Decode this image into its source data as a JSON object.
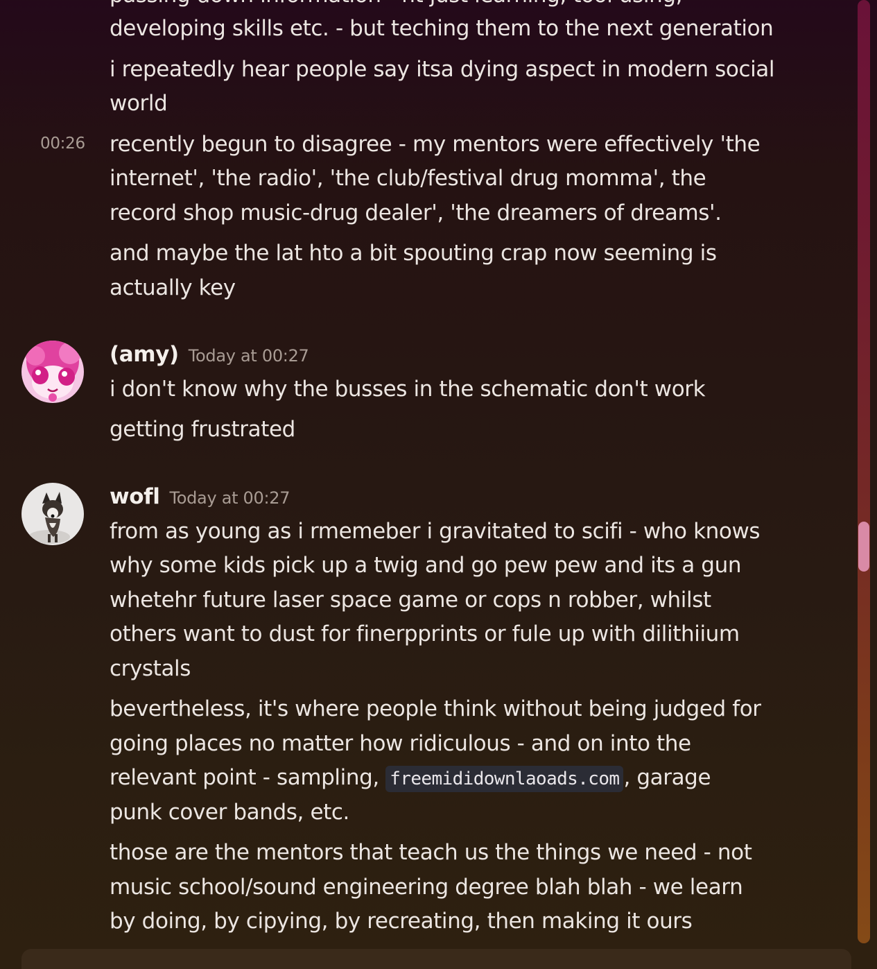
{
  "messages": {
    "cont1": {
      "partial_line": "passing down information - nt just learning, tool using,",
      "line2": "developing skills etc. - but teching them to the next generation"
    },
    "cont2": {
      "line1": "i repeatedly hear people say itsa dying aspect in modern social",
      "line2": "world"
    },
    "cont3": {
      "timestamp": "00:26",
      "line1": "recently begun to disagree - my mentors were effectively 'the",
      "line2": "internet', 'the radio', 'the club/festival drug momma', the",
      "line3": "record shop music-drug dealer', 'the dreamers of dreams'."
    },
    "cont4": {
      "line1": "and maybe the lat hto a bit spouting crap now seeming is",
      "line2": "actually key"
    },
    "amy": {
      "author": "(amy)",
      "timestamp": "Today at 00:27",
      "msg1": "i don't know why the busses in the schematic don't work",
      "msg2": "getting frustrated"
    },
    "wofl": {
      "author": "wofl",
      "timestamp": "Today at 00:27",
      "msg1_line1": "from as young as i rmemeber i gravitated to scifi - who knows",
      "msg1_line2": "why some kids pick up a twig and go pew pew and its a gun",
      "msg1_line3": "whetehr future laser space game or cops n robber, whilst",
      "msg1_line4": "others want to dust for finerpprints or fule up with dilithiium",
      "msg1_line5": "crystals",
      "msg2_line1": "bevertheless, it's where people think without being judged for",
      "msg2_line2": "going places no matter how ridiculous - and on into the",
      "msg2_line3_pre": "relevant point - sampling, ",
      "msg2_line3_code": "freemididownlaoads.com",
      "msg2_line3_post": ", garage",
      "msg2_line4": "punk cover bands, etc.",
      "msg3_line1": "those are the mentors that teach us the things we need - not",
      "msg3_line2": "music school/sound engineering degree blah blah - we learn",
      "msg3_line3": "by doing, by cipying, by recreating, then making it ours"
    }
  },
  "colors": {
    "text": "#ece6e2",
    "muted": "#a99c94",
    "scrollbar_thumb": "#d98aa6",
    "code_bg": "#2b2c35"
  },
  "icons": {
    "amy_avatar": "anime-pink-avatar",
    "wofl_avatar": "husky-dog-avatar"
  }
}
